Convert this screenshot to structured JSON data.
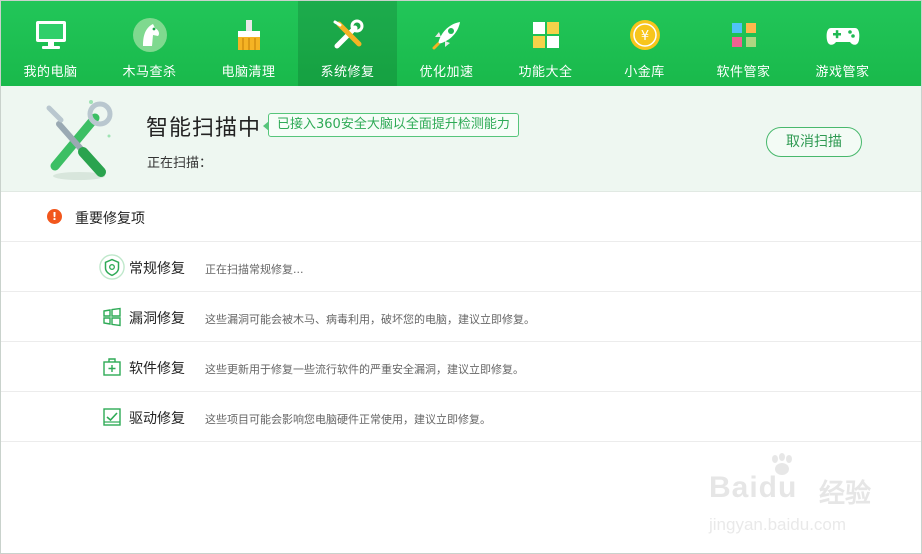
{
  "nav": {
    "items": [
      {
        "label": "我的电脑",
        "icon": "monitor-icon"
      },
      {
        "label": "木马查杀",
        "icon": "trojan-horse-icon"
      },
      {
        "label": "电脑清理",
        "icon": "broom-icon"
      },
      {
        "label": "系统修复",
        "icon": "wrench-screwdriver-icon",
        "active": true
      },
      {
        "label": "优化加速",
        "icon": "rocket-icon"
      },
      {
        "label": "功能大全",
        "icon": "grid-icon"
      },
      {
        "label": "小金库",
        "icon": "coin-icon"
      },
      {
        "label": "软件管家",
        "icon": "software-icon"
      },
      {
        "label": "游戏管家",
        "icon": "gamepad-icon"
      }
    ]
  },
  "scan": {
    "title": "智能扫描中",
    "tag": "已接入360安全大脑以全面提升检测能力",
    "status": "正在扫描：",
    "cancel_label": "取消扫描"
  },
  "repair": {
    "section_title": "重要修复项",
    "section_icon_glyph": "!",
    "rows": [
      {
        "name": "常规修复",
        "desc": "正在扫描常规修复...",
        "icon": "shield-icon"
      },
      {
        "name": "漏洞修复",
        "desc": "这些漏洞可能会被木马、病毒利用，破坏您的电脑，建议立即修复。",
        "icon": "windows-icon"
      },
      {
        "name": "软件修复",
        "desc": "这些更新用于修复一些流行软件的严重安全漏洞，建议立即修复。",
        "icon": "software-box-icon"
      },
      {
        "name": "驱动修复",
        "desc": "这些项目可能会影响您电脑硬件正常使用，建议立即修复。",
        "icon": "driver-icon"
      }
    ]
  },
  "watermark": {
    "brand": "Baidu",
    "brand_cn": "经验",
    "url": "jingyan.baidu.com"
  },
  "colors": {
    "nav_green": "#1fc156",
    "accent_green": "#2eaa56",
    "warning_orange": "#f2571d"
  }
}
